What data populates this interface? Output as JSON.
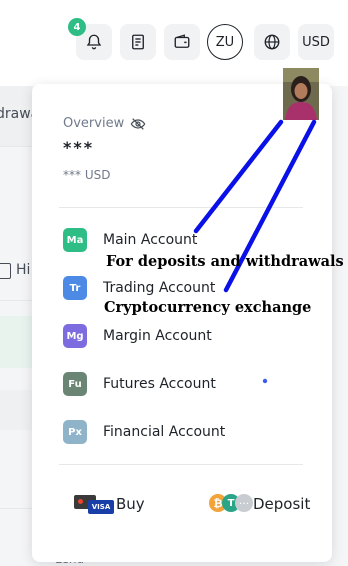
{
  "header": {
    "notification_count": "4",
    "avatar_initials": "ZU",
    "currency": "USD",
    "icons": [
      "bell-icon",
      "document-icon",
      "wallet-icon",
      "globe-icon"
    ]
  },
  "background": {
    "partial_text_1": "drawa",
    "partial_text_2": "Hi",
    "partial_text_3": "Lend"
  },
  "overview": {
    "label": "Overview",
    "balance": "***",
    "balance_usd": "*** USD"
  },
  "accounts": [
    {
      "badge": "Ma",
      "label": "Main Account",
      "color": "#2ebd85"
    },
    {
      "badge": "Tr",
      "label": "Trading Account",
      "color": "#4c8ae6"
    },
    {
      "badge": "Mg",
      "label": "Margin Account",
      "color": "#7d6ce0"
    },
    {
      "badge": "Fu",
      "label": "Futures Account",
      "color": "#6b8575"
    },
    {
      "badge": "Px",
      "label": "Financial Account",
      "color": "#8fb3c9"
    }
  ],
  "footer": {
    "buy_label": "Buy",
    "deposit_label": "Deposit",
    "card_brand": "VISA"
  },
  "annotations": {
    "main_note": "For deposits and withdrawals",
    "trading_note": "Cryptocurrency exchange",
    "line_color": "#0a10e8"
  }
}
